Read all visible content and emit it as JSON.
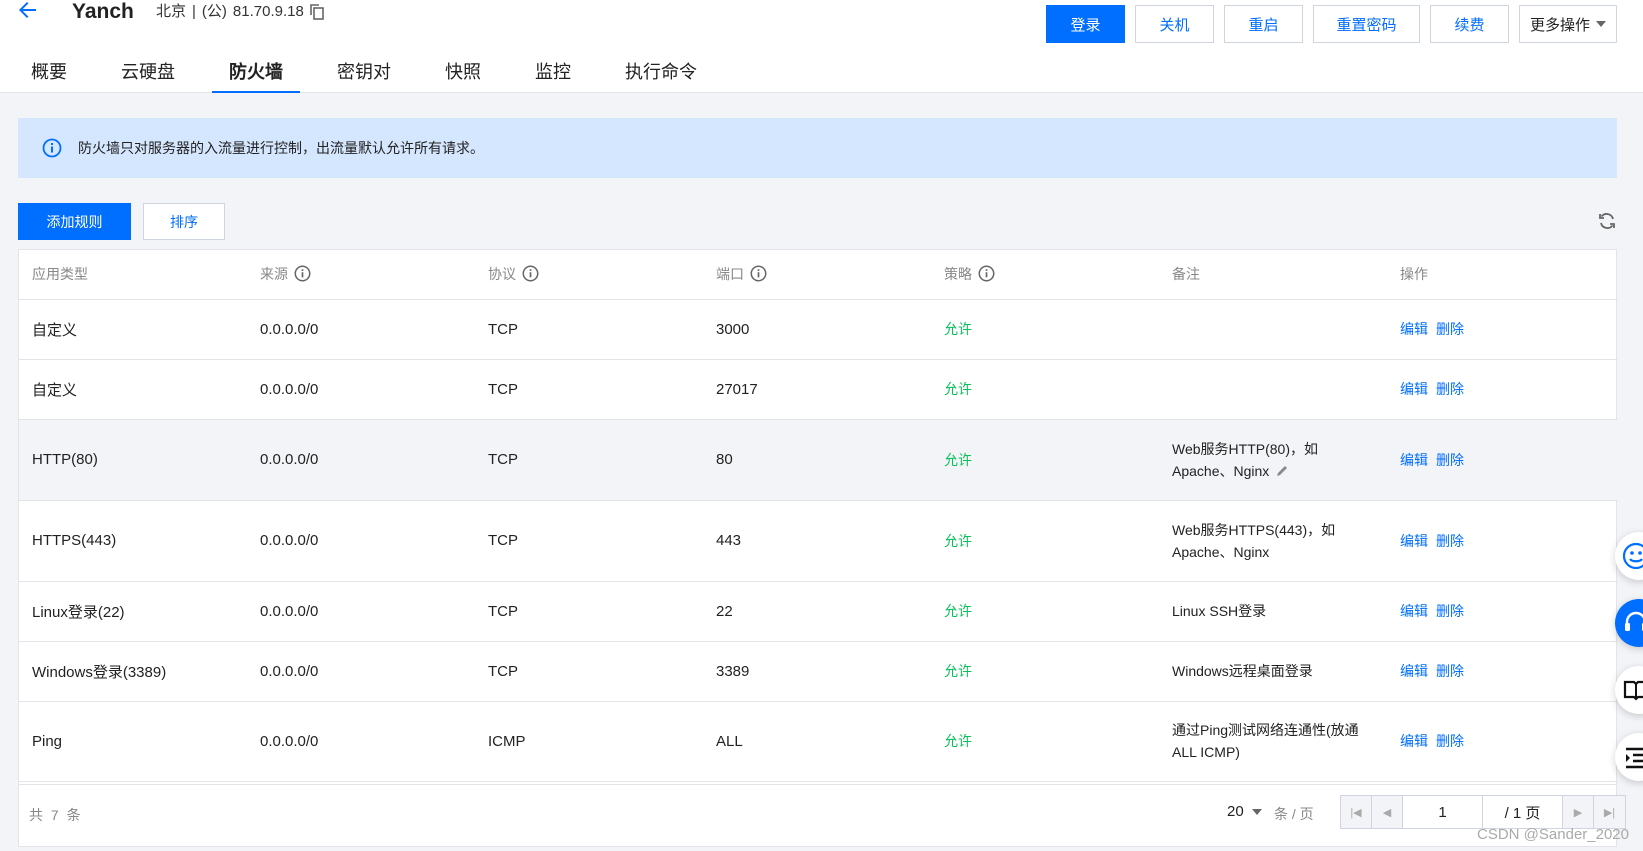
{
  "header": {
    "instance_name": "Yanch",
    "region": "北京",
    "separator": "|",
    "ip_label": "(公)",
    "ip": "81.70.9.18",
    "actions": [
      "登录",
      "关机",
      "重启",
      "重置密码",
      "续费"
    ],
    "more_label": "更多操作"
  },
  "tabs": [
    "概要",
    "云硬盘",
    "防火墙",
    "密钥对",
    "快照",
    "监控",
    "执行命令"
  ],
  "active_tab": "防火墙",
  "notice": "防火墙只对服务器的入流量进行控制，出流量默认允许所有请求。",
  "toolbar": {
    "add_label": "添加规则",
    "sort_label": "排序"
  },
  "table": {
    "columns": [
      "应用类型",
      "来源",
      "协议",
      "端口",
      "策略",
      "备注",
      "操作"
    ],
    "info_columns": [
      1,
      2,
      3,
      4
    ],
    "rows": [
      {
        "type": "自定义",
        "source": "0.0.0.0/0",
        "protocol": "TCP",
        "port": "3000",
        "policy": "允许",
        "remark_1": "",
        "remark_2": ""
      },
      {
        "type": "自定义",
        "source": "0.0.0.0/0",
        "protocol": "TCP",
        "port": "27017",
        "policy": "允许",
        "remark_1": "",
        "remark_2": ""
      },
      {
        "type": "HTTP(80)",
        "source": "0.0.0.0/0",
        "protocol": "TCP",
        "port": "80",
        "policy": "允许",
        "remark_1": "Web服务HTTP(80)，如",
        "remark_2": "Apache、Nginx"
      },
      {
        "type": "HTTPS(443)",
        "source": "0.0.0.0/0",
        "protocol": "TCP",
        "port": "443",
        "policy": "允许",
        "remark_1": "Web服务HTTPS(443)，如",
        "remark_2": "Apache、Nginx"
      },
      {
        "type": "Linux登录(22)",
        "source": "0.0.0.0/0",
        "protocol": "TCP",
        "port": "22",
        "policy": "允许",
        "remark_1": "Linux SSH登录",
        "remark_2": ""
      },
      {
        "type": "Windows登录(3389)",
        "source": "0.0.0.0/0",
        "protocol": "TCP",
        "port": "3389",
        "policy": "允许",
        "remark_1": "Windows远程桌面登录",
        "remark_2": ""
      },
      {
        "type": "Ping",
        "source": "0.0.0.0/0",
        "protocol": "ICMP",
        "port": "ALL",
        "policy": "允许",
        "remark_1": "通过Ping测试网络连通性(放通",
        "remark_2": "ALL ICMP)"
      }
    ],
    "edit_label": "编辑",
    "delete_label": "删除"
  },
  "footer": {
    "total_text": "共 7 条",
    "page_size": "20",
    "per_page_label": "条 / 页",
    "current_page": "1",
    "total_pages_text": "/ 1 页"
  },
  "watermark": "CSDN @Sander_2020",
  "colors": {
    "accent": "#006eff",
    "allow": "#0abf5b",
    "notice_bg": "#d5e7fe"
  }
}
